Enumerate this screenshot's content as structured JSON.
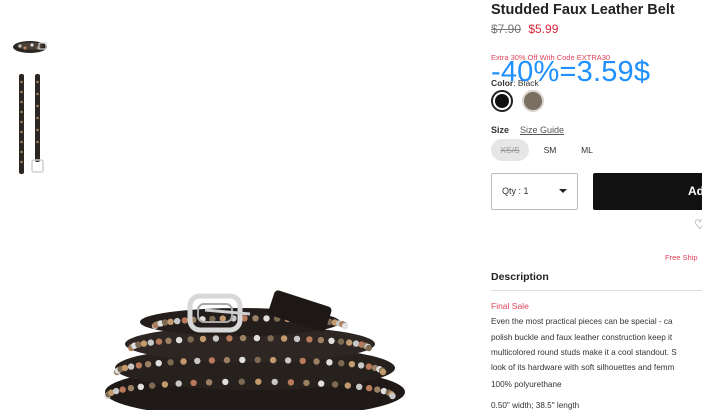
{
  "product": {
    "title": "Studded Faux Leather Belt",
    "original_price": "$7.90",
    "sale_price": "$5.99",
    "promo_text": "Extra 30% Off With Code EXTRA30",
    "overlay_text": "-40%=3.59$",
    "color_label": "Color",
    "color_value": ": Black",
    "swatches": [
      {
        "name": "Black",
        "hex": "#111111"
      },
      {
        "name": "Taupe",
        "hex": "#7b6f62"
      }
    ],
    "size_label": "Size",
    "size_guide": "Size Guide",
    "sizes": [
      "XS/S",
      "SM",
      "ML"
    ],
    "quantity_label": "Qty : 1",
    "add_button": "Ad",
    "shipping_text": "Free Ship",
    "description_heading": "Description",
    "final_sale": "Final Sale",
    "description_lines": [
      "Even the most practical pieces can be special - ca",
      "polish buckle and faux leather construction keep it",
      "multicolored round studs make it a cool standout. S",
      "look of its hardware with soft silhouettes and femm"
    ],
    "material": "100% polyurethane",
    "dimensions": "0.50\" width; 38.5\" length"
  },
  "colors": {
    "sale_red": "#d9263a",
    "promo_pink": "#e0435a",
    "overlay_blue": "#1e90ff",
    "button_black": "#111111"
  },
  "icons": {
    "wishlist": "heart-icon",
    "dropdown": "caret-down-icon"
  }
}
